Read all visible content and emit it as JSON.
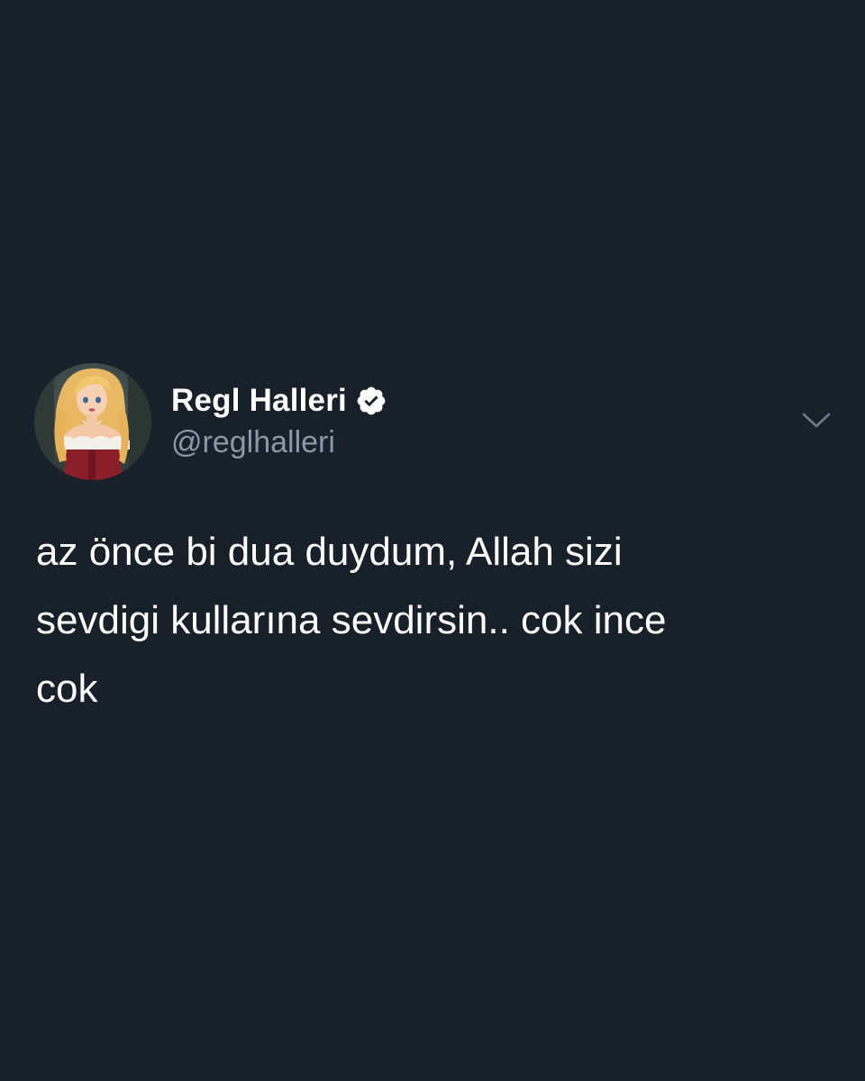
{
  "tweet": {
    "author": {
      "display_name": "Regl Halleri",
      "handle": "@reglhalleri",
      "verified": true,
      "avatar_icon": "illustrated-princess-avatar"
    },
    "text": "az önce bi dua duydum, Allah sizi\nsevdigi kullarına sevdirsin.. cok ince\ncok",
    "menu_icon": "chevron-down-icon"
  },
  "colors": {
    "background": "#18202a",
    "primary_text": "#ffffff",
    "secondary_text": "#8b98a5",
    "verified_badge": "#ffffff"
  }
}
